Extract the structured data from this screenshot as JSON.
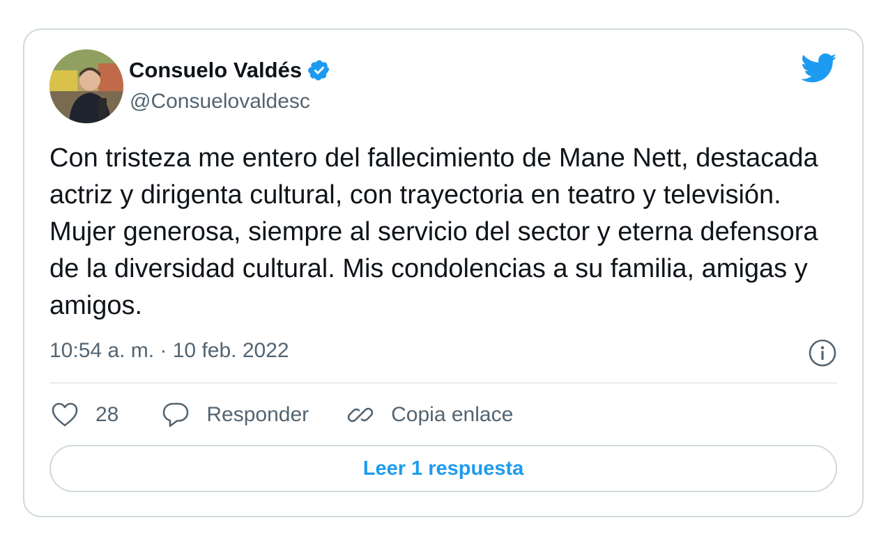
{
  "author": {
    "display_name": "Consuelo Valdés",
    "handle": "@Consuelovaldesc",
    "verified": true
  },
  "tweet": {
    "text": "Con tristeza me entero del fallecimiento de Mane Nett, destacada actriz y dirigenta cultural, con trayectoria en teatro y televisión. Mujer generosa, siempre al servicio del sector y eterna defensora de la diversidad cultural. Mis condolencias a su familia, amigas y amigos.",
    "timestamp": "10:54 a. m. · 10 feb. 2022"
  },
  "actions": {
    "likes_count": "28",
    "reply_label": "Responder",
    "copy_link_label": "Copia enlace"
  },
  "read_replies_label": "Leer 1 respuesta",
  "colors": {
    "accent": "#1d9bf0",
    "text": "#0f1419",
    "secondary_text": "#536471",
    "border": "#cfd9de"
  },
  "icons": [
    "twitter-bird-icon",
    "verified-badge-icon",
    "info-icon",
    "heart-icon",
    "reply-icon",
    "link-icon"
  ]
}
